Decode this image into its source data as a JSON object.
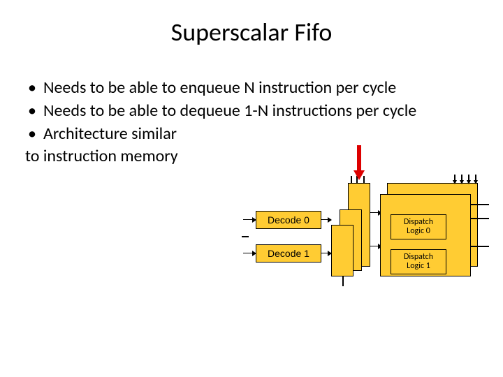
{
  "title": "Superscalar Fifo",
  "bullets": [
    "Needs to be able to enqueue N instruction per cycle",
    "Needs to be able to dequeue 1-N instructions per cycle",
    "Architecture similar"
  ],
  "continuation": "to instruction memory",
  "diagram": {
    "decode0": "Decode 0",
    "decode1": "Decode 1",
    "dispatch0_l1": "Dispatch",
    "dispatch0_l2": "Logic 0",
    "dispatch1_l1": "Dispatch",
    "dispatch1_l2": "Logic 1"
  }
}
